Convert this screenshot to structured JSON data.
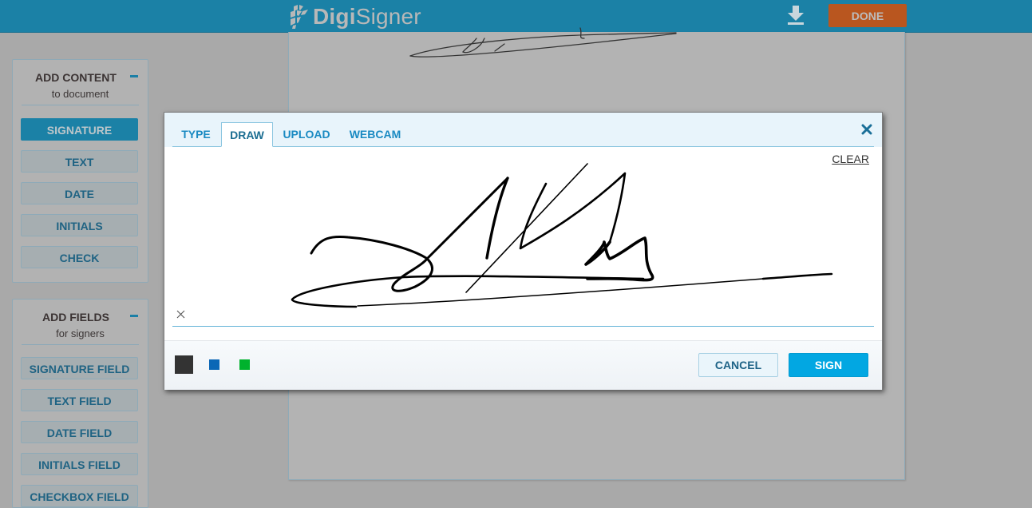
{
  "header": {
    "logo_bold": "Digi",
    "logo_light": "Signer",
    "download_icon": "download-icon",
    "done_label": "DONE",
    "colors": {
      "bar": "#1b81a6",
      "done": "#b9561f"
    }
  },
  "add_content": {
    "title": "ADD CONTENT",
    "subtitle": "to document",
    "collapse_icon": "minus-icon",
    "buttons": [
      {
        "label": "SIGNATURE",
        "active": true
      },
      {
        "label": "TEXT",
        "active": false
      },
      {
        "label": "DATE",
        "active": false
      },
      {
        "label": "INITIALS",
        "active": false
      },
      {
        "label": "CHECK",
        "active": false
      }
    ]
  },
  "add_fields": {
    "title": "ADD FIELDS",
    "subtitle": "for signers",
    "collapse_icon": "minus-icon",
    "buttons": [
      {
        "label": "SIGNATURE FIELD"
      },
      {
        "label": "TEXT FIELD"
      },
      {
        "label": "DATE FIELD"
      },
      {
        "label": "INITIALS FIELD"
      },
      {
        "label": "CHECKBOX FIELD"
      }
    ]
  },
  "modal": {
    "tabs": [
      {
        "label": "TYPE",
        "active": false
      },
      {
        "label": "DRAW",
        "active": true
      },
      {
        "label": "UPLOAD",
        "active": false
      },
      {
        "label": "WEBCAM",
        "active": false
      }
    ],
    "close_icon": "close-icon",
    "clear_label": "CLEAR",
    "baseline_marker": "x-mark-icon",
    "pen_colors": [
      {
        "name": "black",
        "hex": "#333333",
        "selected": true
      },
      {
        "name": "blue",
        "hex": "#0b67b6",
        "selected": false
      },
      {
        "name": "green",
        "hex": "#00b22d",
        "selected": false
      }
    ],
    "cancel_label": "CANCEL",
    "sign_label": "SIGN",
    "colors": {
      "sign": "#02a7e2",
      "tab_text": "#1a8ac2"
    }
  }
}
